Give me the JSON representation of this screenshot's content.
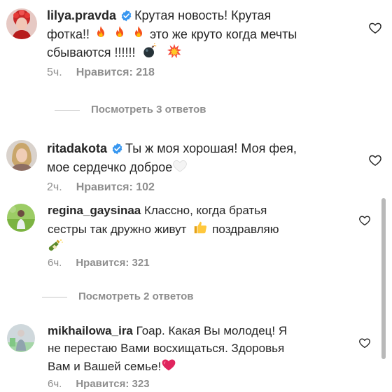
{
  "comments": [
    {
      "username": "lilya.pravda",
      "verified": true,
      "lines": [
        "Крутая новость! Крутая",
        "фотка!!",
        "это же круто когда мечты",
        "сбываются !!!!!!"
      ],
      "time": "5ч.",
      "likes": "Нравится: 218"
    },
    {
      "username": "ritadakota",
      "verified": true,
      "lines": [
        "Ты ж моя хорошая! Моя фея,",
        "мое сердечко доброе"
      ],
      "time": "2ч.",
      "likes": "Нравится: 102"
    },
    {
      "username": "regina_gaysinaa",
      "verified": false,
      "lines": [
        "Классно, когда братья",
        "сестры так дружно живут",
        "поздравляю"
      ],
      "time": "6ч.",
      "likes": "Нравится: 321"
    },
    {
      "username": "mikhailowa_ira",
      "verified": false,
      "lines": [
        "Гоар. Какая Вы молодец! Я",
        "не перестаю Вами восхищаться. Здоровья",
        "Вам и Вашей семье!"
      ],
      "time": "6ч.",
      "likes": "Нравится: 323"
    }
  ],
  "view_replies": [
    "Посмотреть 3 ответов",
    "Посмотреть 2 ответов"
  ],
  "icons": {
    "verified": "verified-badge-icon",
    "like": "heart-outline-icon",
    "fire": "fire-emoji",
    "bomb": "bomb-emoji",
    "sparkle": "collision-emoji",
    "white_heart": "white-heart-emoji",
    "thumbs_up": "thumbs-up-emoji",
    "champagne": "champagne-emoji",
    "red_heart": "red-heart-emoji"
  },
  "colors": {
    "text": "#262626",
    "secondary": "#8e8e8e",
    "verified_blue": "#3897f0",
    "divider": "#c7c7c7"
  }
}
